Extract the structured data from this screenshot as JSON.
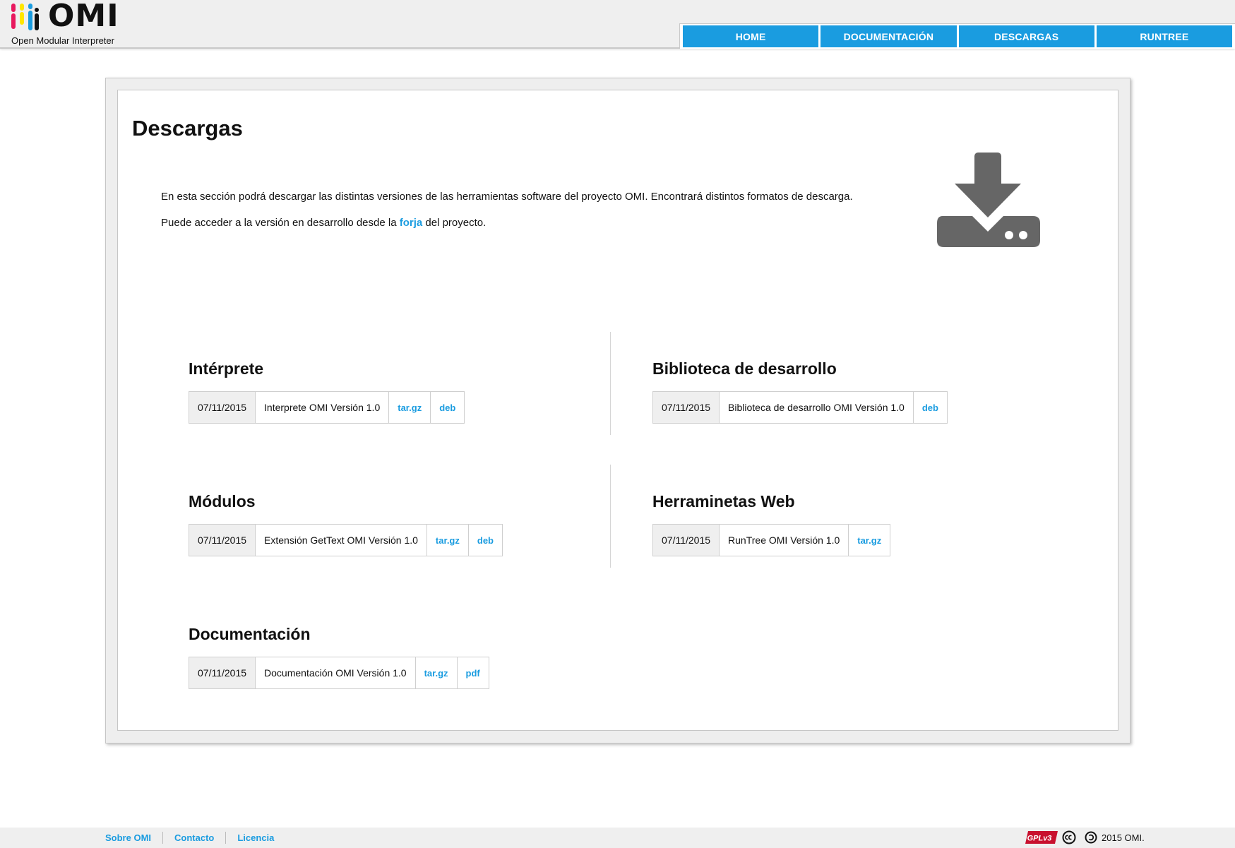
{
  "header": {
    "brand": "OMI",
    "tagline": "Open Modular Interpreter",
    "logo_colors": [
      "#e8185e",
      "#ffe600",
      "#1a9ce0",
      "#111111"
    ],
    "nav": [
      {
        "label": "HOME"
      },
      {
        "label": "DOCUMENTACIÓN"
      },
      {
        "label": "DESCARGAS"
      },
      {
        "label": "RUNTREE"
      }
    ]
  },
  "main": {
    "title": "Descargas",
    "intro_1": "En esta sección podrá descargar las distintas versiones de las herramientas software del proyecto OMI. Encontrará distintos formatos de descarga.",
    "intro_2_before": "Puede acceder a la versión en desarrollo desde la ",
    "intro_2_link": "forja",
    "intro_2_after": " del proyecto.",
    "hero_icon": "download-drive-icon",
    "sections": {
      "interprete": {
        "title": "Intérprete",
        "date": "07/11/2015",
        "name": "Interprete OMI Versión 1.0",
        "formats": [
          "tar.gz",
          "deb"
        ]
      },
      "biblioteca": {
        "title": "Biblioteca de desarrollo",
        "date": "07/11/2015",
        "name": "Biblioteca de desarrollo OMI Versión 1.0",
        "formats": [
          "deb"
        ]
      },
      "modulos": {
        "title": "Módulos",
        "date": "07/11/2015",
        "name": "Extensión GetText OMI Versión 1.0",
        "formats": [
          "tar.gz",
          "deb"
        ]
      },
      "herramientas": {
        "title": "Herraminetas Web",
        "date": "07/11/2015",
        "name": "RunTree OMI Versión 1.0",
        "formats": [
          "tar.gz"
        ]
      },
      "documentacion": {
        "title": "Documentación",
        "date": "07/11/2015",
        "name": "Documentación OMI Versión 1.0",
        "formats": [
          "tar.gz",
          "pdf"
        ]
      }
    }
  },
  "footer": {
    "links": [
      {
        "label": "Sobre OMI"
      },
      {
        "label": "Contacto"
      },
      {
        "label": "Licencia"
      }
    ],
    "gpl_badge": "GPLv3",
    "copyright": "2015 OMI."
  },
  "colors": {
    "accent": "#1a9ce0",
    "header_bg": "#efefef",
    "icon_gray": "#666666"
  }
}
